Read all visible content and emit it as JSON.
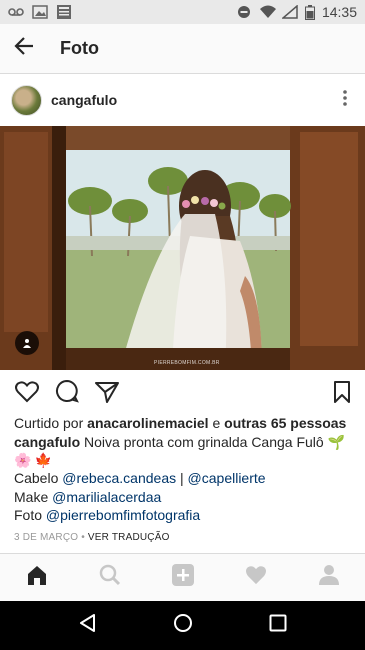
{
  "status_bar": {
    "time": "14:35",
    "icons": [
      "voicemail-icon",
      "image-icon",
      "news-icon",
      "do-not-disturb-icon",
      "wifi-icon",
      "signal-icon",
      "battery-icon"
    ]
  },
  "app_bar": {
    "title": "Foto",
    "back_icon": "arrow-left-icon"
  },
  "post": {
    "username": "cangafulo",
    "more_icon": "more-vertical-icon",
    "photo_watermark": "PIERREBOMFIM.COM.BR",
    "likes": {
      "prefix": "Curtido por ",
      "first_user": "anacarolinemaciel",
      "conjunction": " e ",
      "others": "outras 65 pessoas"
    },
    "caption": {
      "username": "cangafulo",
      "text": " Noiva pronta com grinalda Canga Fulô ",
      "emoji_1": "🌱",
      "emoji_2": "🌸",
      "emoji_3": "🍁"
    },
    "lines": [
      {
        "label": "Cabelo ",
        "tags": [
          "@rebeca.candeas",
          "@capellierte"
        ],
        "sep": " | "
      },
      {
        "label": "Make ",
        "tags": [
          "@marilialacerdaa"
        ]
      },
      {
        "label": "Foto ",
        "tags": [
          "@pierrebomfimfotografia"
        ]
      }
    ],
    "date": "3 DE MARÇO",
    "dot": " • ",
    "translate": "VER TRADUÇÃO"
  },
  "bottom_nav": [
    "home-icon",
    "search-icon",
    "add-icon",
    "heart-icon",
    "profile-icon"
  ],
  "colors": {
    "text": "#262626",
    "link": "#003569",
    "muted": "#999999",
    "status_bg": "#e9e9e9"
  }
}
